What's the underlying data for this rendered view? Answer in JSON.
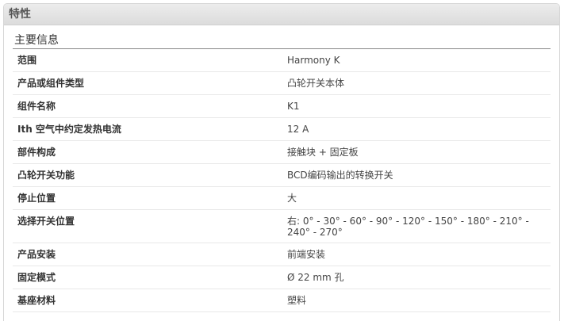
{
  "panel": {
    "title": "特性"
  },
  "section": {
    "title": "主要信息"
  },
  "rows": [
    {
      "label": "范围",
      "value": "Harmony K"
    },
    {
      "label": "产品或组件类型",
      "value": "凸轮开关本体"
    },
    {
      "label": "组件名称",
      "value": "K1"
    },
    {
      "label": "Ith 空气中约定发热电流",
      "value": "12 A"
    },
    {
      "label": "部件构成",
      "value": "接触块 + 固定板"
    },
    {
      "label": "凸轮开关功能",
      "value": "BCD编码输出的转换开关"
    },
    {
      "label": "停止位置",
      "value": "大"
    },
    {
      "label": "选择开关位置",
      "value": "右: 0° - 30° - 60° - 90° - 120° - 150° - 180° - 210° - 240° - 270°"
    },
    {
      "label": "产品安装",
      "value": "前端安装"
    },
    {
      "label": "固定模式",
      "value": "Ø 22 mm 孔"
    },
    {
      "label": "基座材料",
      "value": "塑料"
    }
  ]
}
